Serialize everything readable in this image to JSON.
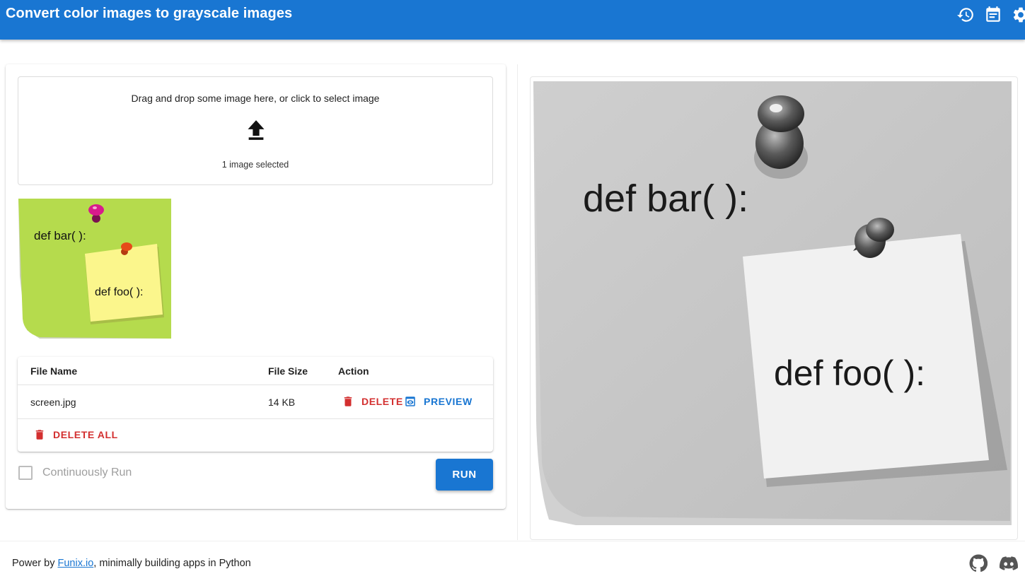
{
  "app": {
    "title": "Convert color images to grayscale images",
    "icons": [
      "history-icon",
      "calendar-note-icon",
      "settings-icon"
    ]
  },
  "dropzone": {
    "instruction": "Drag and drop some image here, or click to select image",
    "icon": "upload-icon",
    "status": "1 image selected"
  },
  "thumbnail": {
    "note_main": "def bar( ):",
    "note_small": "def foo( ):",
    "colors": {
      "green_note": "#b5db4d",
      "yellow_note": "#fbf68c",
      "pin_magenta": "#d81b8c",
      "pin_red": "#e64a19"
    }
  },
  "file_table": {
    "headers": [
      "File Name",
      "File Size",
      "Action"
    ],
    "rows": [
      {
        "name": "screen.jpg",
        "size": "14 KB",
        "delete_label": "DELETE",
        "preview_label": "PREVIEW"
      }
    ],
    "delete_all_label": "DELETE ALL"
  },
  "controls": {
    "continuous_label": "Continuously Run",
    "continuous_checked": false,
    "run_label": "RUN"
  },
  "preview": {
    "note_main": "def bar( ):",
    "note_small": "def foo( ):"
  },
  "footer": {
    "prefix": "Power by ",
    "link": "Funix.io",
    "suffix": ", minimally building apps in Python",
    "icons": [
      "github-icon",
      "discord-icon"
    ]
  },
  "colors": {
    "primary": "#1976d2",
    "danger": "#d32f2f"
  }
}
